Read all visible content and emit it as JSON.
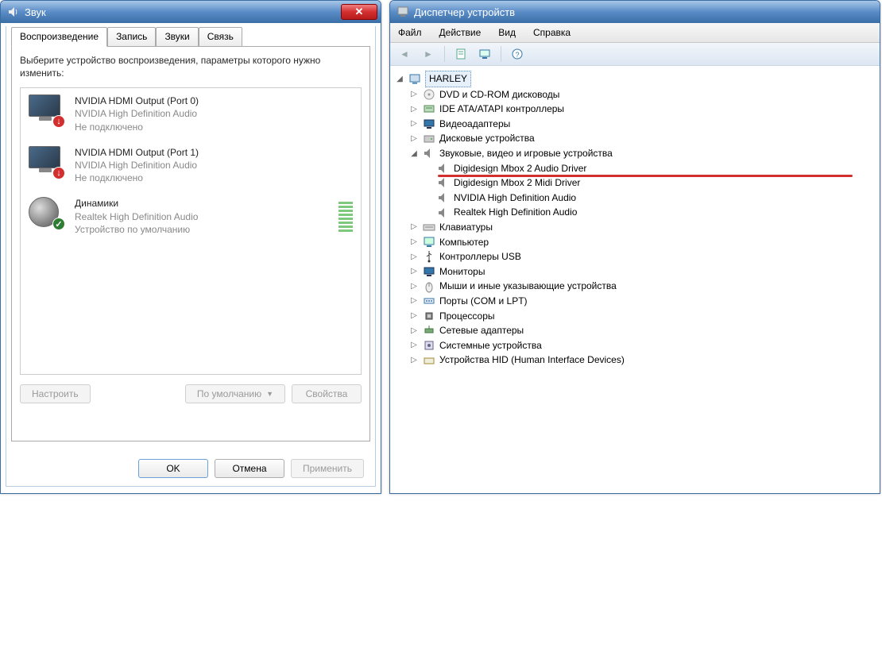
{
  "sound": {
    "title": "Звук",
    "tabs": [
      "Воспроизведение",
      "Запись",
      "Звуки",
      "Связь"
    ],
    "instruction": "Выберите устройство воспроизведения, параметры которого нужно изменить:",
    "devices": [
      {
        "name": "NVIDIA HDMI Output (Port 0)",
        "sub": "NVIDIA High Definition Audio",
        "status": "Не подключено",
        "badge": "err"
      },
      {
        "name": "NVIDIA HDMI Output (Port 1)",
        "sub": "NVIDIA High Definition Audio",
        "status": "Не подключено",
        "badge": "err"
      },
      {
        "name": "Динамики",
        "sub": "Realtek High Definition Audio",
        "status": "Устройство по умолчанию",
        "badge": "ok"
      }
    ],
    "btn_configure": "Настроить",
    "btn_default": "По умолчанию",
    "btn_properties": "Свойства",
    "btn_ok": "OK",
    "btn_cancel": "Отмена",
    "btn_apply": "Применить"
  },
  "devmgr": {
    "title": "Диспетчер устройств",
    "menu": [
      "Файл",
      "Действие",
      "Вид",
      "Справка"
    ],
    "root": "HARLEY",
    "categories": [
      {
        "label": "DVD и CD-ROM дисководы",
        "icon": "disc"
      },
      {
        "label": "IDE ATA/ATAPI контроллеры",
        "icon": "ide"
      },
      {
        "label": "Видеоадаптеры",
        "icon": "display"
      },
      {
        "label": "Дисковые устройства",
        "icon": "hdd"
      },
      {
        "label": "Звуковые, видео и игровые устройства",
        "icon": "sound",
        "expanded": true,
        "children": [
          {
            "label": "Digidesign Mbox 2 Audio Driver",
            "highlight": true
          },
          {
            "label": "Digidesign Mbox 2 Midi Driver"
          },
          {
            "label": "NVIDIA High Definition Audio"
          },
          {
            "label": "Realtek High Definition Audio"
          }
        ]
      },
      {
        "label": "Клавиатуры",
        "icon": "keyboard"
      },
      {
        "label": "Компьютер",
        "icon": "computer"
      },
      {
        "label": "Контроллеры USB",
        "icon": "usb"
      },
      {
        "label": "Мониторы",
        "icon": "monitor"
      },
      {
        "label": "Мыши и иные указывающие устройства",
        "icon": "mouse"
      },
      {
        "label": "Порты (COM и LPT)",
        "icon": "port"
      },
      {
        "label": "Процессоры",
        "icon": "cpu"
      },
      {
        "label": "Сетевые адаптеры",
        "icon": "net"
      },
      {
        "label": "Системные устройства",
        "icon": "system"
      },
      {
        "label": "Устройства HID (Human Interface Devices)",
        "icon": "hid"
      }
    ]
  }
}
